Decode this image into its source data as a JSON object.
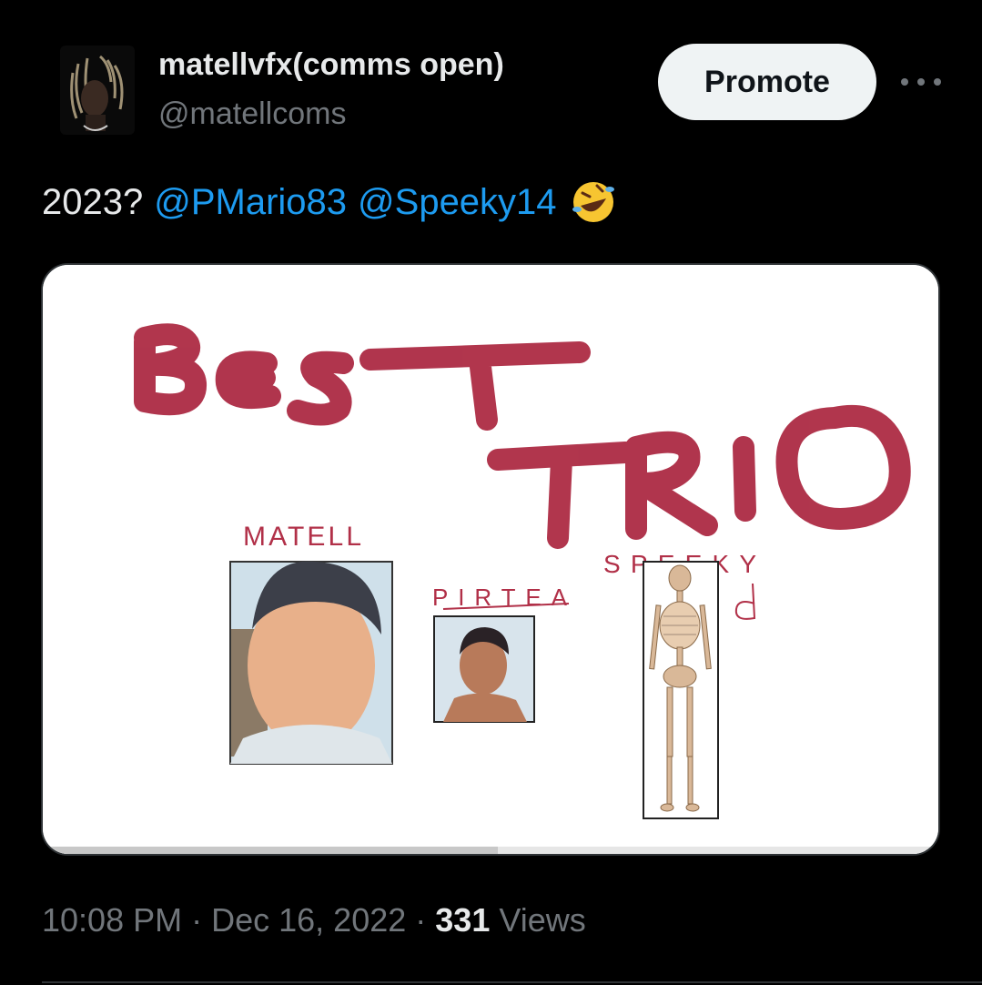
{
  "author": {
    "name": "matellvfx(comms open)",
    "handle": "@matellcoms"
  },
  "actions": {
    "promote_label": "Promote"
  },
  "tweet": {
    "text_prefix": "2023?",
    "mentions": [
      "@PMario83",
      "@Speeky14"
    ],
    "emoji": "rolling-on-floor-laughing"
  },
  "media": {
    "headline_words": [
      "BEST",
      "TRIO"
    ],
    "labels": [
      "MATELL",
      "PIRTEA",
      "SPEEKY"
    ]
  },
  "meta": {
    "time": "10:08 PM",
    "date": "Dec 16, 2022",
    "views_count": "331",
    "views_label": "Views"
  },
  "colors": {
    "accent": "#1d9bf0",
    "scribble": "#a8203a",
    "background": "#000000"
  }
}
